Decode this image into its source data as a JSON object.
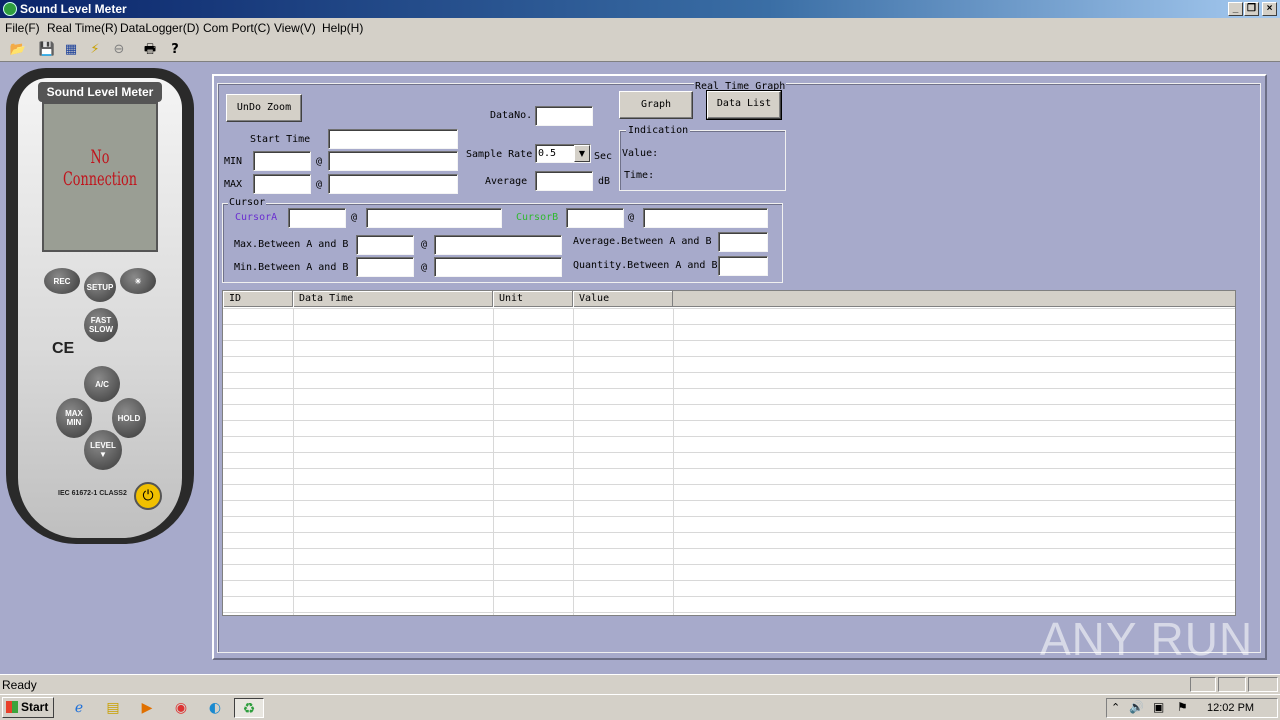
{
  "window": {
    "title": "Sound Level Meter"
  },
  "menu": [
    "File(F)",
    "Real Time(R)",
    "DataLogger(D)",
    "Com Port(C)",
    "View(V)",
    "Help(H)"
  ],
  "device": {
    "title": "Sound Level Meter",
    "lcd_text": "No Connection",
    "buttons": {
      "rec": "REC",
      "setup": "SETUP",
      "fast_slow": "FAST\nSLOW",
      "ac": "A/C",
      "maxmin": "MAX\nMIN",
      "hold": "HOLD",
      "level": "LEVEL\n▼"
    },
    "ce": "CE",
    "standard": "IEC 61672-1 CLASS2"
  },
  "panel": {
    "group_title": "Real Time Graph",
    "undo_zoom": "UnDo Zoom",
    "start_time": "Start Time",
    "min": "MIN",
    "max": "MAX",
    "at": "@",
    "data_no": "DataNo.",
    "sample_rate": "Sample Rate",
    "sample_rate_value": "0.5",
    "sec": "Sec",
    "average": "Average",
    "db": "dB",
    "graph_button": "Graph",
    "data_list_button": "Data List",
    "indication": {
      "title": "Indication",
      "value": "Value:",
      "time": "Time:"
    },
    "cursor": {
      "title": "Cursor",
      "cursor_a": "CursorA",
      "cursor_b": "CursorB",
      "max_between": "Max.Between A and B",
      "min_between": "Min.Between A and B",
      "avg_between": "Average.Between A and B",
      "qty_between": "Quantity.Between A and B"
    },
    "table_headers": [
      "ID",
      "Data Time",
      "Unit",
      "Value"
    ]
  },
  "status": {
    "text": "Ready"
  },
  "taskbar": {
    "start": "Start",
    "clock": "12:02 PM"
  },
  "watermark": "ANY RUN",
  "colors": {
    "workspace": "#a7aacb",
    "cursor_a": "#6a2fd0",
    "cursor_b": "#2fb82f",
    "lcd_text": "#c0141c"
  }
}
